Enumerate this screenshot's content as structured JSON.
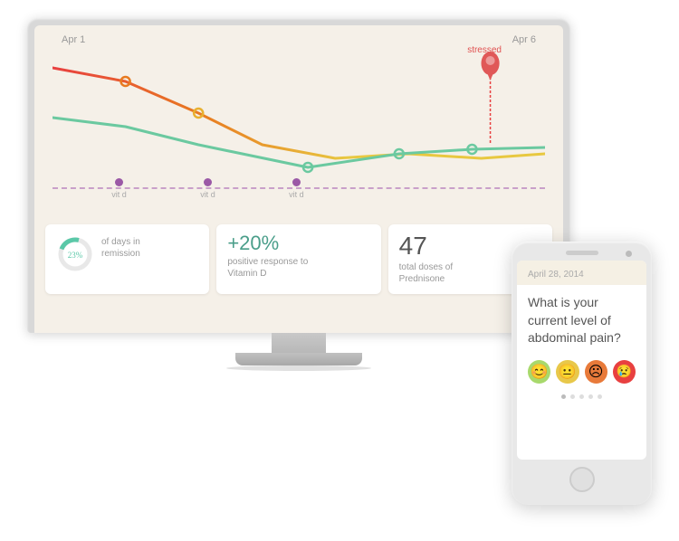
{
  "monitor": {
    "chart": {
      "date_left": "Apr 1",
      "date_right": "Apr 6",
      "stressed_label": "stressed",
      "timeline_dots": [
        {
          "label": "vit d",
          "left_pct": 15
        },
        {
          "label": "vit d",
          "left_pct": 32
        },
        {
          "label": "vit d",
          "left_pct": 50
        }
      ]
    },
    "stats": [
      {
        "type": "donut",
        "percentage": 23,
        "value": "23%",
        "description": "of days in\nremission"
      },
      {
        "type": "plus",
        "value": "+20%",
        "description": "positive response to\nVitamin D"
      },
      {
        "type": "number",
        "value": "47",
        "description": "total doses of\nPrednisone"
      }
    ]
  },
  "phone": {
    "date": "April 28, 2014",
    "question": "What is your current level of abdominal pain?",
    "emojis": [
      "😊",
      "😐",
      "😟",
      "😢"
    ],
    "emoji_colors": [
      "#a8d96c",
      "#e8c84a",
      "#e87a3a",
      "#e84040"
    ],
    "dots_count": 5,
    "active_dot": 0
  }
}
